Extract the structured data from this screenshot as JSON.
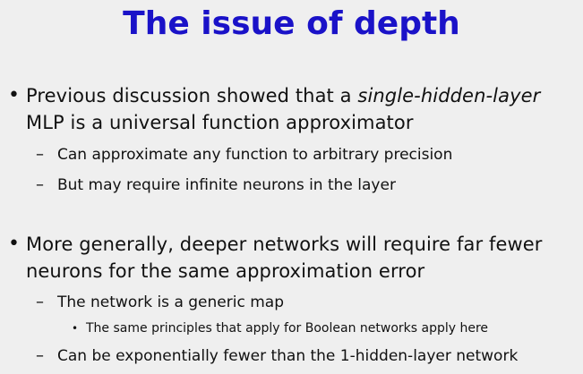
{
  "slide": {
    "title": "The issue of depth",
    "bullets": [
      {
        "mark": "•",
        "text_before": "Previous discussion showed that a ",
        "text_italic": "single-hidden-layer",
        "text_after": " MLP is a universal function approximator",
        "sub": [
          {
            "mark": "–",
            "text": "Can approximate any function to arbitrary precision"
          },
          {
            "mark": "–",
            "text": "But may require infinite neurons in the layer"
          }
        ]
      },
      {
        "mark": "•",
        "text": "More generally, deeper networks will require far fewer neurons for the same approximation error",
        "sub": [
          {
            "mark": "–",
            "text": "The network is a generic map",
            "sub": [
              {
                "mark": "•",
                "text": "The same principles that apply for Boolean networks apply here"
              }
            ]
          },
          {
            "mark": "–",
            "text": "Can be exponentially fewer than the 1-hidden-layer network"
          }
        ]
      }
    ]
  }
}
